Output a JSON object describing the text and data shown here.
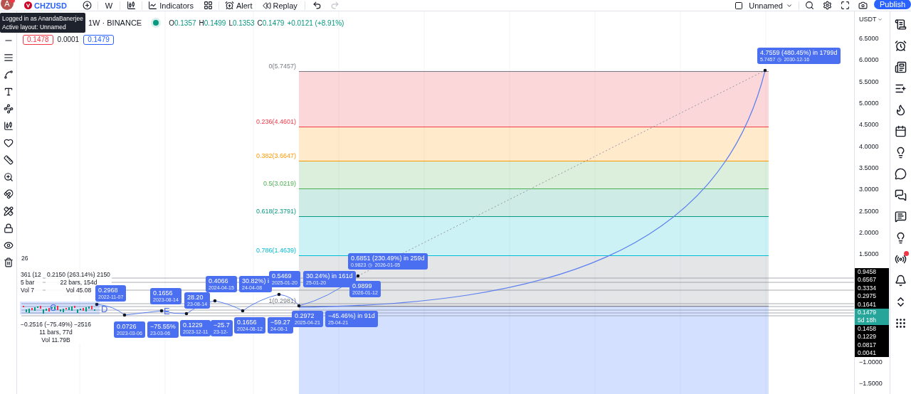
{
  "top_toolbar": {
    "avatar": "A",
    "symbol": "CHZUSD",
    "interval": "W",
    "indicators": "Indicators",
    "alert": "Alert",
    "replay": "Replay",
    "layout": "Unnamed",
    "publish": "Publish"
  },
  "tooltip": [
    "Logged in as AnandaBanerjee",
    "Active layout: Unnamed"
  ],
  "legend": {
    "title": "1W · BINANCE",
    "ohlc": [
      {
        "key": "O",
        "value": "0.1357"
      },
      {
        "key": "H",
        "value": "0.1499"
      },
      {
        "key": "L",
        "value": "0.1353"
      },
      {
        "key": "C",
        "value": "0.1479"
      }
    ],
    "change": "+0.0121 (+8.91%)",
    "sell": "0.1478",
    "spread": "0.0001",
    "buy": "0.1479"
  },
  "fib_levels": [
    {
      "label": "0(5.7457)",
      "color": "#787b86"
    },
    {
      "label": "0.236(4.4601)",
      "color": "#f23645"
    },
    {
      "label": "0.382(3.6647)",
      "color": "#ff9800"
    },
    {
      "label": "0.5(3.0219)",
      "color": "#4caf50"
    },
    {
      "label": "0.618(2.3791)",
      "color": "#089981"
    },
    {
      "label": "0.786(1.4639)",
      "color": "#00bcd4"
    },
    {
      "label": "1(0.2981)",
      "color": "#787b86"
    }
  ],
  "projection_labels": [
    {
      "main": "4.7559 (480.45%) in 1799d",
      "sub": "5.7457",
      "date": "2030-12-16"
    },
    {
      "main": "0.6851 (230.49%) in 259d",
      "sub": "0.9823",
      "date": "2026-01-05"
    },
    {
      "main": "0.5469",
      "sub": "2025-01-20"
    },
    {
      "main": "30.24%) in 161d",
      "sub": "25-01-20"
    },
    {
      "main": "0.9899",
      "sub": "2026-01-12"
    },
    {
      "main": "0.4066",
      "sub": "2024-04-15"
    },
    {
      "main": "30.82%) i",
      "sub": "24-04-08"
    },
    {
      "main": "0.2968",
      "sub": "2022-11-07"
    },
    {
      "main": "0.1656",
      "sub": "2023-08-14"
    },
    {
      "main": "28.20",
      "sub": "23-08-14"
    },
    {
      "main": "0.0726",
      "sub": "2023-03-06"
    },
    {
      "main": "−75.55%",
      "sub": "23-03-06"
    },
    {
      "main": "0.1229",
      "sub": "2023-12-11"
    },
    {
      "main": "−25.7",
      "sub": "23-12-"
    },
    {
      "main": "0.1656",
      "sub": "2024-08-12"
    },
    {
      "main": "−59.27",
      "sub": "24-08-1"
    },
    {
      "main": "0.2972",
      "sub": "2025-04-21"
    },
    {
      "main": "−45.46%) in 91d",
      "sub": "25-04-21"
    }
  ],
  "stats_boxes": [
    {
      "lines": [
        "26"
      ]
    },
    {
      "lines": [
        "361 (12",
        "5 bar",
        "Vol 7"
      ]
    },
    {
      "lines": [
        "0.2150 (263.14%) 2150",
        "22 bars, 154d",
        "Vol 45.08"
      ]
    },
    {
      "lines": [
        "−0.2516 (−75.49%) −2516",
        "11 bars, 77d",
        "Vol 11.79B"
      ]
    }
  ],
  "point_letters": [
    "C",
    "D",
    "E"
  ],
  "price_axis": {
    "currency": "USDT",
    "ticks": [
      "6.5000",
      "6.0000",
      "5.5000",
      "5.0000",
      "4.5000",
      "4.0000",
      "3.5000",
      "3.0000",
      "2.5000",
      "2.0000",
      "1.5000",
      "−1.0000",
      "−1.5000"
    ],
    "badges_above": [
      "0.9458",
      "0.6567",
      "0.3334",
      "0.2975",
      "0.1641"
    ],
    "last_price": {
      "price": "0.1479",
      "countdown": "5d 18h"
    },
    "badges_below": [
      "0.1458",
      "0.1229",
      "0.0817",
      "0.0041"
    ]
  }
}
